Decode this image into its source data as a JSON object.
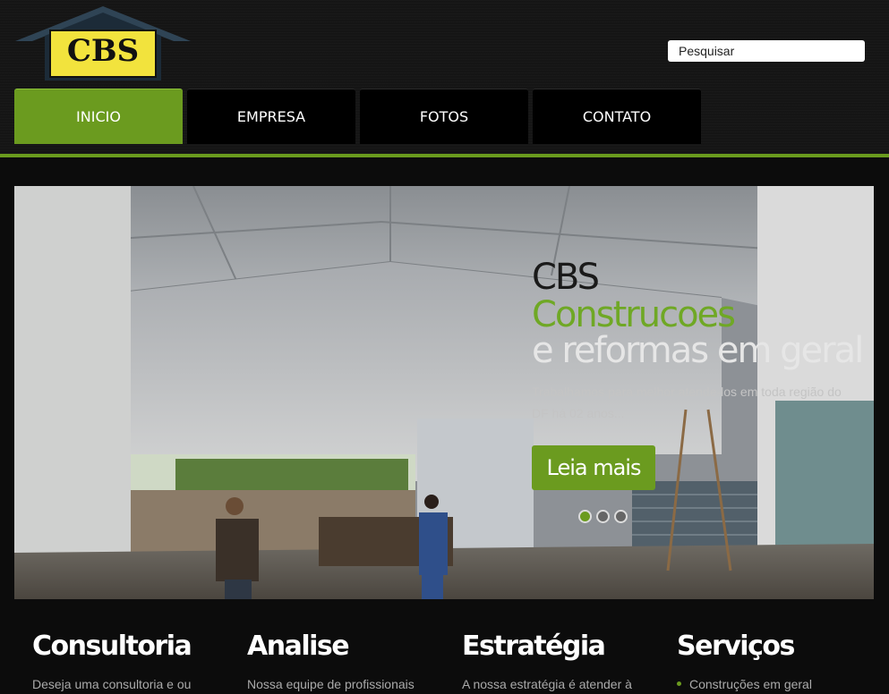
{
  "logo": {
    "text": "CBS"
  },
  "search": {
    "placeholder": "Pesquisar"
  },
  "nav": {
    "items": [
      "INICIO",
      "EMPRESA",
      "FOTOS",
      "CONTATO"
    ],
    "active": 0
  },
  "slider": {
    "heading_1": "CBS",
    "heading_2": "Construcoes",
    "heading_3": "e reformas em geral",
    "text": "Trabalhamos para melhor atende-los em toda região do DF há 02 anos...",
    "button": "Leia mais",
    "slide_count": 3,
    "active_slide": 1
  },
  "columns": [
    {
      "title": "Consultoria",
      "text": "Deseja uma consultoria e ou"
    },
    {
      "title": "Analise",
      "text": "Nossa equipe de profissionais"
    },
    {
      "title": "Estratégia",
      "text": "A nossa estratégia é atender à"
    },
    {
      "title": "Serviços",
      "items": [
        "Construções em geral"
      ]
    }
  ],
  "colors": {
    "accent": "#6b9b1f",
    "background": "#0c0c0c"
  }
}
